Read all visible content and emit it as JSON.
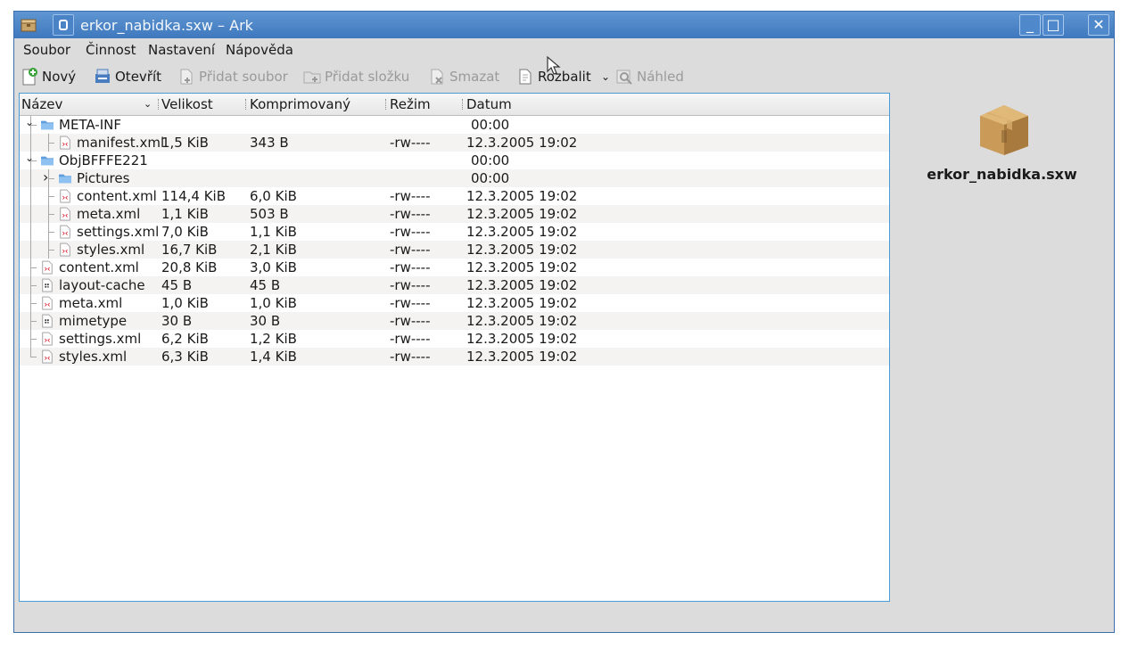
{
  "window": {
    "title": "erkor_nabidka.sxw – Ark",
    "minimize_glyph": "_",
    "maximize_glyph": "□",
    "close_glyph": "✕"
  },
  "menu": [
    "Soubor",
    "Činnost",
    "Nastavení",
    "Nápověda"
  ],
  "toolbar": {
    "new": "Nový",
    "open": "Otevřít",
    "add_file": "Přidat soubor",
    "add_folder": "Přidat složku",
    "delete": "Smazat",
    "extract": "Rozbalit",
    "preview": "Náhled"
  },
  "columns": [
    "Název",
    "Velikost",
    "Komprimovaný",
    "Režim",
    "Datum"
  ],
  "rows": [
    {
      "name": "META-INF",
      "size": "",
      "comp": "",
      "mode": "",
      "date": "00:00",
      "depth": 0,
      "type": "folder",
      "expanded": true
    },
    {
      "name": "manifest.xml",
      "size": "1,5 KiB",
      "comp": "343 B",
      "mode": "-rw----",
      "date": "12.3.2005 19:02",
      "depth": 1,
      "type": "xml"
    },
    {
      "name": "ObjBFFFE221",
      "size": "",
      "comp": "",
      "mode": "",
      "date": "00:00",
      "depth": 0,
      "type": "folder",
      "expanded": true
    },
    {
      "name": "Pictures",
      "size": "",
      "comp": "",
      "mode": "",
      "date": "00:00",
      "depth": 1,
      "type": "folder",
      "expanded": false
    },
    {
      "name": "content.xml",
      "size": "114,4 KiB",
      "comp": "6,0 KiB",
      "mode": "-rw----",
      "date": "12.3.2005 19:02",
      "depth": 1,
      "type": "xml"
    },
    {
      "name": "meta.xml",
      "size": "1,1 KiB",
      "comp": "503 B",
      "mode": "-rw----",
      "date": "12.3.2005 19:02",
      "depth": 1,
      "type": "xml"
    },
    {
      "name": "settings.xml",
      "size": "7,0 KiB",
      "comp": "1,1 KiB",
      "mode": "-rw----",
      "date": "12.3.2005 19:02",
      "depth": 1,
      "type": "xml"
    },
    {
      "name": "styles.xml",
      "size": "16,7 KiB",
      "comp": "2,1 KiB",
      "mode": "-rw----",
      "date": "12.3.2005 19:02",
      "depth": 1,
      "type": "xml"
    },
    {
      "name": "content.xml",
      "size": "20,8 KiB",
      "comp": "3,0 KiB",
      "mode": "-rw----",
      "date": "12.3.2005 19:02",
      "depth": 0,
      "type": "xml"
    },
    {
      "name": "layout-cache",
      "size": "45 B",
      "comp": "45 B",
      "mode": "-rw----",
      "date": "12.3.2005 19:02",
      "depth": 0,
      "type": "bin"
    },
    {
      "name": "meta.xml",
      "size": "1,0 KiB",
      "comp": "1,0 KiB",
      "mode": "-rw----",
      "date": "12.3.2005 19:02",
      "depth": 0,
      "type": "xml"
    },
    {
      "name": "mimetype",
      "size": "30 B",
      "comp": "30 B",
      "mode": "-rw----",
      "date": "12.3.2005 19:02",
      "depth": 0,
      "type": "bin"
    },
    {
      "name": "settings.xml",
      "size": "6,2 KiB",
      "comp": "1,2 KiB",
      "mode": "-rw----",
      "date": "12.3.2005 19:02",
      "depth": 0,
      "type": "xml"
    },
    {
      "name": "styles.xml",
      "size": "6,3 KiB",
      "comp": "1,4 KiB",
      "mode": "-rw----",
      "date": "12.3.2005 19:02",
      "depth": 0,
      "type": "xml"
    }
  ],
  "sidebar": {
    "archive_name": "erkor_nabidka.sxw"
  }
}
